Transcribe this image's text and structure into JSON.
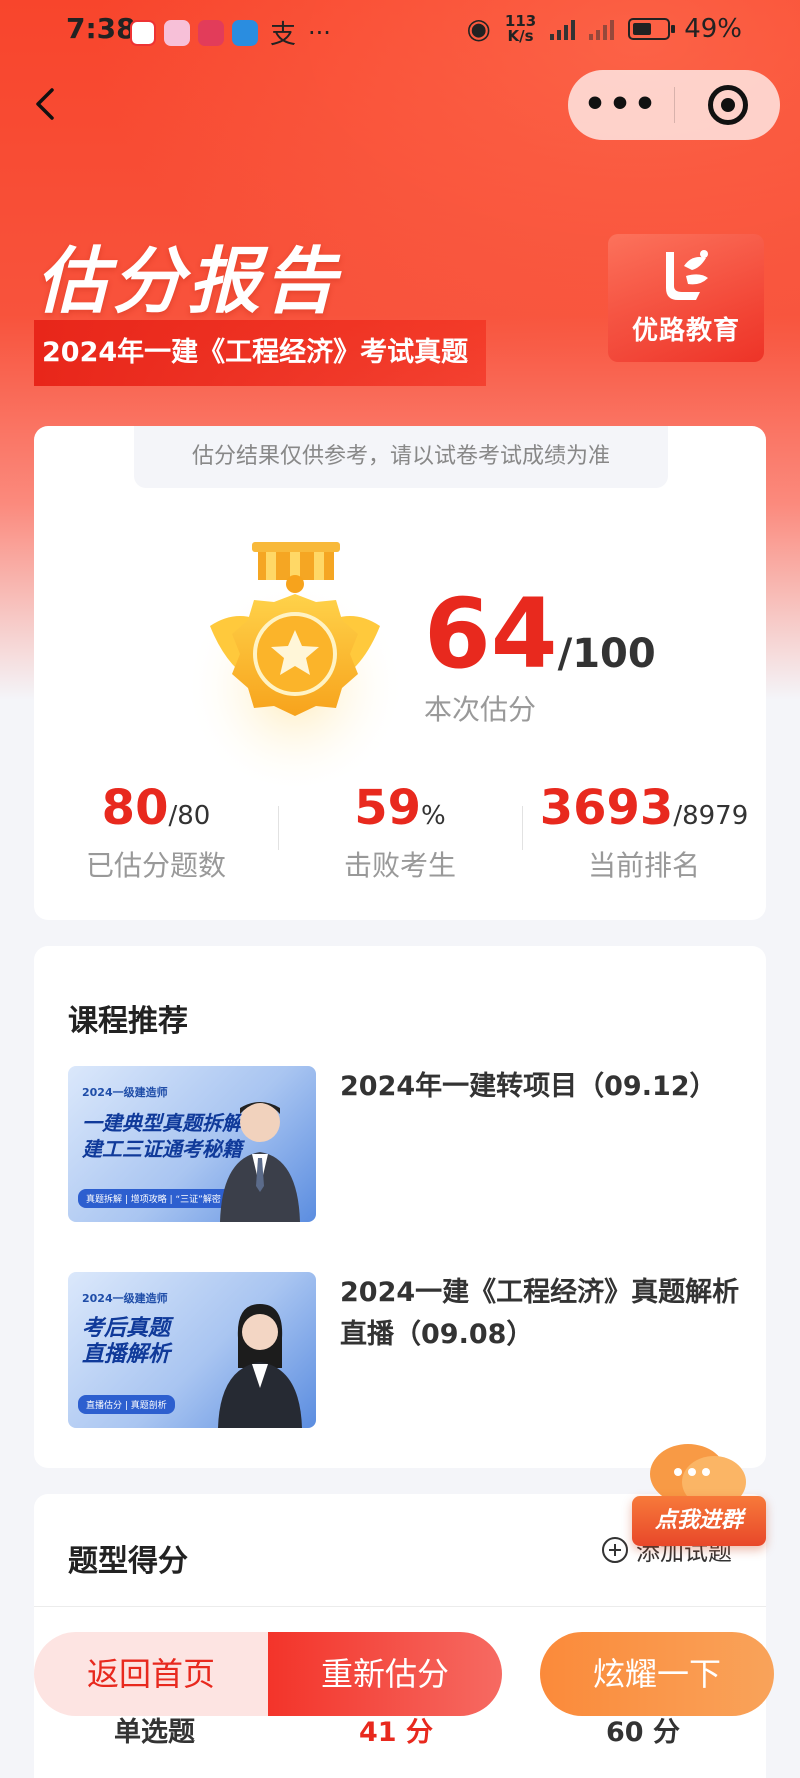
{
  "status_bar": {
    "time": "7:38",
    "pay_icon": "支",
    "more": "···",
    "net_speed_value": "113",
    "net_speed_unit": "K/s",
    "battery": "49%"
  },
  "nav": {
    "more": "•••"
  },
  "header": {
    "title": "估分报告",
    "subtitle": "2024年一建《工程经济》考试真题",
    "brand_name": "优路教育"
  },
  "score_card": {
    "disclaimer": "估分结果仅供参考，请以试卷考试成绩为准",
    "score": "64",
    "score_total": "/100",
    "score_label": "本次估分",
    "stats": [
      {
        "value": "80",
        "suffix": "/80",
        "label": "已估分题数"
      },
      {
        "value": "59",
        "suffix": "%",
        "label": "击败考生"
      },
      {
        "value": "3693",
        "suffix": "/8979",
        "label": "当前排名"
      }
    ]
  },
  "courses": {
    "title": "课程推荐",
    "items": [
      {
        "title": "2024年一建转项目（09.12）",
        "thumb_tag": "2024一级建造师",
        "thumb_headline_1": "一建典型真题拆解",
        "thumb_headline_2": "建工三证通考秘籍",
        "thumb_footer": "真题拆解 | 增项攻略 | “三证”解密 | 转岗优势"
      },
      {
        "title": "2024一建《工程经济》真题解析直播（09.08）",
        "thumb_tag": "2024一级建造师",
        "thumb_headline_1": "考后真题",
        "thumb_headline_2": "直播解析",
        "thumb_footer": "直播估分 | 真题剖析"
      }
    ]
  },
  "question_types": {
    "title": "题型得分",
    "add_label": "添加试题",
    "rows": [
      {
        "type": "单选题",
        "score": "41 分",
        "total": "60 分"
      }
    ]
  },
  "float_group": {
    "label": "点我进群"
  },
  "bottom_bar": {
    "home": "返回首页",
    "redo": "重新估分",
    "share": "炫耀一下"
  },
  "colors": {
    "accent_red": "#e8291e",
    "header_red": "#f8452c",
    "orange": "#fb8a3a"
  }
}
